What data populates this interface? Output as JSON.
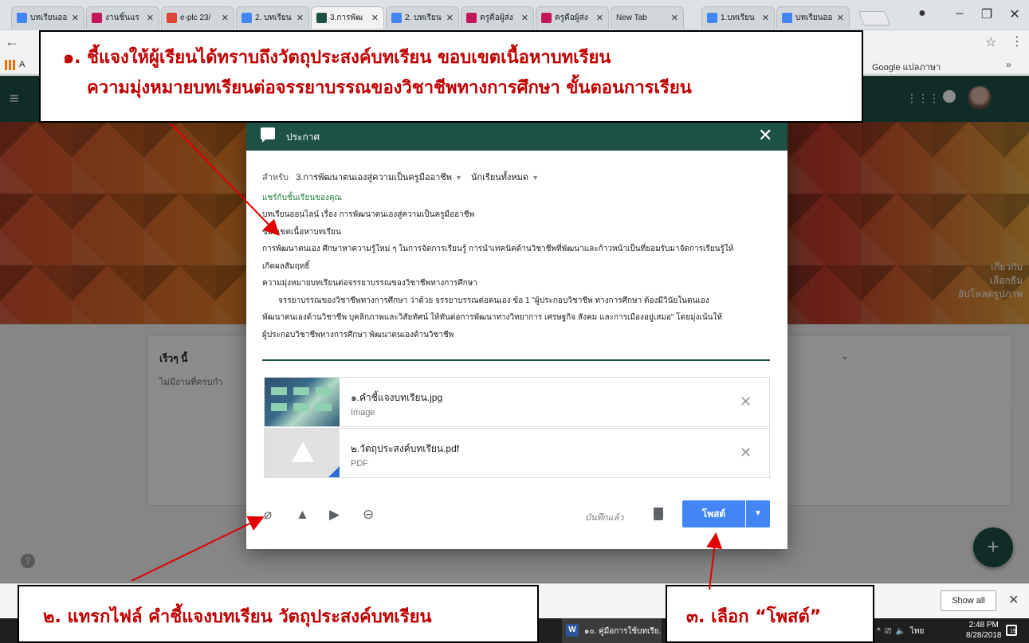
{
  "browser": {
    "tabs": [
      {
        "label": "บทเรียนออ",
        "color": "#4285f4"
      },
      {
        "label": "งานชิ้นแร",
        "color": "#c2185b"
      },
      {
        "label": "e-plc 23/",
        "color": "#db4437"
      },
      {
        "label": "2. บทเรียน",
        "color": "#4285f4"
      },
      {
        "label": "3.การพัฒ",
        "color": "#1e5145"
      },
      {
        "label": "2. บทเรียน",
        "color": "#4285f4"
      },
      {
        "label": "ครูคือผู้ส่ง",
        "color": "#c2185b"
      },
      {
        "label": "ครูคือผู้ส่ง",
        "color": "#c2185b"
      },
      {
        "label": "New Tab",
        "color": ""
      },
      {
        "label": "1.บทเรียน",
        "color": "#4285f4"
      },
      {
        "label": "บทเรียนออ",
        "color": "#4285f4"
      }
    ],
    "bookmark_apps_label": "A",
    "bookmark_google_translate": "Google แปลภาษา",
    "bookmark_more": "»"
  },
  "classroom": {
    "banner_links": [
      "เกี่ยวกับ",
      "เลือกธีม",
      "อัปโหลดรูปภาพ"
    ],
    "upcoming_title": "เร็วๆ นี้",
    "upcoming_empty": "ไม่มีงานที่ครบกำ"
  },
  "dialog": {
    "title": "ประกาศ",
    "for_label": "สำหรับ",
    "class_select": "3.การพัฒนาตนเองสู่ความเป็นครูมืออาชีพ",
    "students_select": "นักเรียนทั้งหมด",
    "share_label": "แชร์กับชั้นเรียนของคุณ",
    "body_lines": [
      "บทเรียนออนไลน์ เรื่อง การพัฒนาตนเองสู่ความเป็นครูมืออาชีพ",
      "ขอบเขตเนื้อหาบทเรียน",
      "การพัฒนาตนเอง ศึกษาหาความรู้ใหม่ ๆ ในการจัดการเรียนรู้ การนำเทคนิคด้านวิชาชีพที่พัฒนาและก้าวหน้าเป็นที่ยอมรับมาจัดการเรียนรู้ให้",
      "เกิดผลสัมฤทธิ์",
      "ความมุ่งหมายบทเรียนต่อจรรยาบรรณของวิชาชีพทางการศึกษา",
      "จรรยาบรรณของวิชาชีพทางการศึกษา ว่าด้วย จรรยาบรรณต่อตนเอง ข้อ 1 \"ผู้ประกอบวิชาชีพ ทางการศึกษา ต้องมีวินัยในตนเอง",
      "พัฒนาตนเองด้านวิชาชีพ บุคลิกภาพและวิสัยทัศน์ ให้ทันต่อการพัฒนาทางวิทยาการ เศรษฐกิจ สังคม และการเมืองอยู่เสมอ\" โดยมุ่งเน้นให้",
      "ผู้ประกอบวิชาชีพทางการศึกษา พัฒนาตนเองด้านวิชาชีพ"
    ],
    "attachments": [
      {
        "name": "๑.คำชี้แจงบทเรียน.jpg",
        "type": "Image"
      },
      {
        "name": "๒.วัตถุประสงค์บทเรียน.pdf",
        "type": "PDF"
      }
    ],
    "saved_label": "บันทึกแล้ว",
    "post_label": "โพสต์"
  },
  "downloads": {
    "show_all": "Show all",
    "word_item": "๑๐. คู่มือการใช้บทเรีย..."
  },
  "taskbar": {
    "lang": "ไทย",
    "time": "2:48 PM",
    "date": "8/28/2018",
    "notif_count": "19"
  },
  "callouts": {
    "c1_line1": "๑. ชี้แจงให้ผู้เรียนได้ทราบถึงวัตถุประสงค์บทเรียน ขอบเขตเนื้อหาบทเรียน",
    "c1_line2": "ความมุ่งหมายบทเรียนต่อจรรยาบรรณของวิชาชีพทางการศึกษา ขั้นตอนการเรียน",
    "c2": "๒. แทรกไฟล์ คำชี้แจงบทเรียน วัตถุประสงค์บทเรียน",
    "c3": "๓. เลือก “โพสต์”"
  }
}
